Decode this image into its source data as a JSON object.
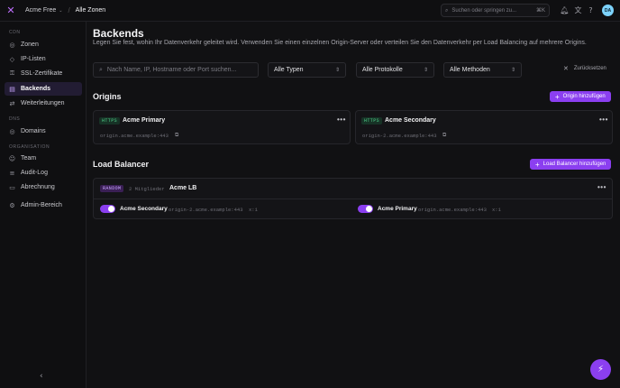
{
  "topbar": {
    "logo": "✕",
    "workspace": "Acme Free",
    "separator": "/",
    "breadcrumb": "Alle Zonen",
    "search_placeholder": "Suchen oder springen zu...",
    "shortcut": "⌘K",
    "avatar": "DA"
  },
  "sidebar": {
    "sections": [
      {
        "title": "CDN",
        "items": [
          {
            "icon": "globe-icon",
            "glyph": "◎",
            "label": "Zonen"
          },
          {
            "icon": "shield-icon",
            "glyph": "◇",
            "label": "IP-Listen"
          },
          {
            "icon": "lock-icon",
            "glyph": "⚿",
            "label": "SSL-Zertifikate"
          },
          {
            "icon": "server-icon",
            "glyph": "▤",
            "label": "Backends",
            "active": true
          },
          {
            "icon": "redirect-icon",
            "glyph": "⇄",
            "label": "Weiterleitungen"
          }
        ]
      },
      {
        "title": "DNS",
        "items": [
          {
            "icon": "globe-icon",
            "glyph": "◎",
            "label": "Domains"
          }
        ]
      },
      {
        "title": "ORGANISATION",
        "items": [
          {
            "icon": "users-icon",
            "glyph": "☺",
            "label": "Team"
          },
          {
            "icon": "list-icon",
            "glyph": "≡",
            "label": "Audit-Log"
          },
          {
            "icon": "card-icon",
            "glyph": "▭",
            "label": "Abrechnung"
          }
        ]
      },
      {
        "title": "",
        "items": [
          {
            "icon": "admin-icon",
            "glyph": "⚙",
            "label": "Admin-Bereich"
          }
        ]
      }
    ],
    "collapse": "‹"
  },
  "page": {
    "title": "Backends",
    "description": "Legen Sie fest, wohin Ihr Datenverkehr geleitet wird. Verwenden Sie einen einzelnen Origin-Server oder verteilen Sie den Datenverkehr per Load Balancing auf mehrere Origins."
  },
  "filters": {
    "search_placeholder": "Nach Name, IP, Hostname oder Port suchen...",
    "type": "Alle Typen",
    "protocol": "Alle Protokolle",
    "method": "Alle Methoden",
    "reset": "Zurücksetzen"
  },
  "origins": {
    "title": "Origins",
    "add_button": "Origin hinzufügen",
    "items": [
      {
        "protocol": "HTTPS",
        "name": "Acme Primary",
        "address": "origin.acme.example:443"
      },
      {
        "protocol": "HTTPS",
        "name": "Acme Secondary",
        "address": "origin-2.acme.example:443"
      }
    ]
  },
  "load_balancer": {
    "title": "Load Balancer",
    "add_button": "Load Balancer hinzufügen",
    "items": [
      {
        "method": "RANDOM",
        "members": "2 Mitglieder",
        "name": "Acme LB",
        "members_list": [
          {
            "enabled": true,
            "name": "Acme Secondary",
            "address": "origin-2.acme.example:443",
            "weight": "x:1"
          },
          {
            "enabled": true,
            "name": "Acme Primary",
            "address": "origin.acme.example:443",
            "weight": "x:1"
          }
        ]
      }
    ]
  },
  "fab": "⚡",
  "colors": {
    "accent": "#8b3ff0",
    "background": "#111113",
    "https_badge": "#4fd08a"
  }
}
